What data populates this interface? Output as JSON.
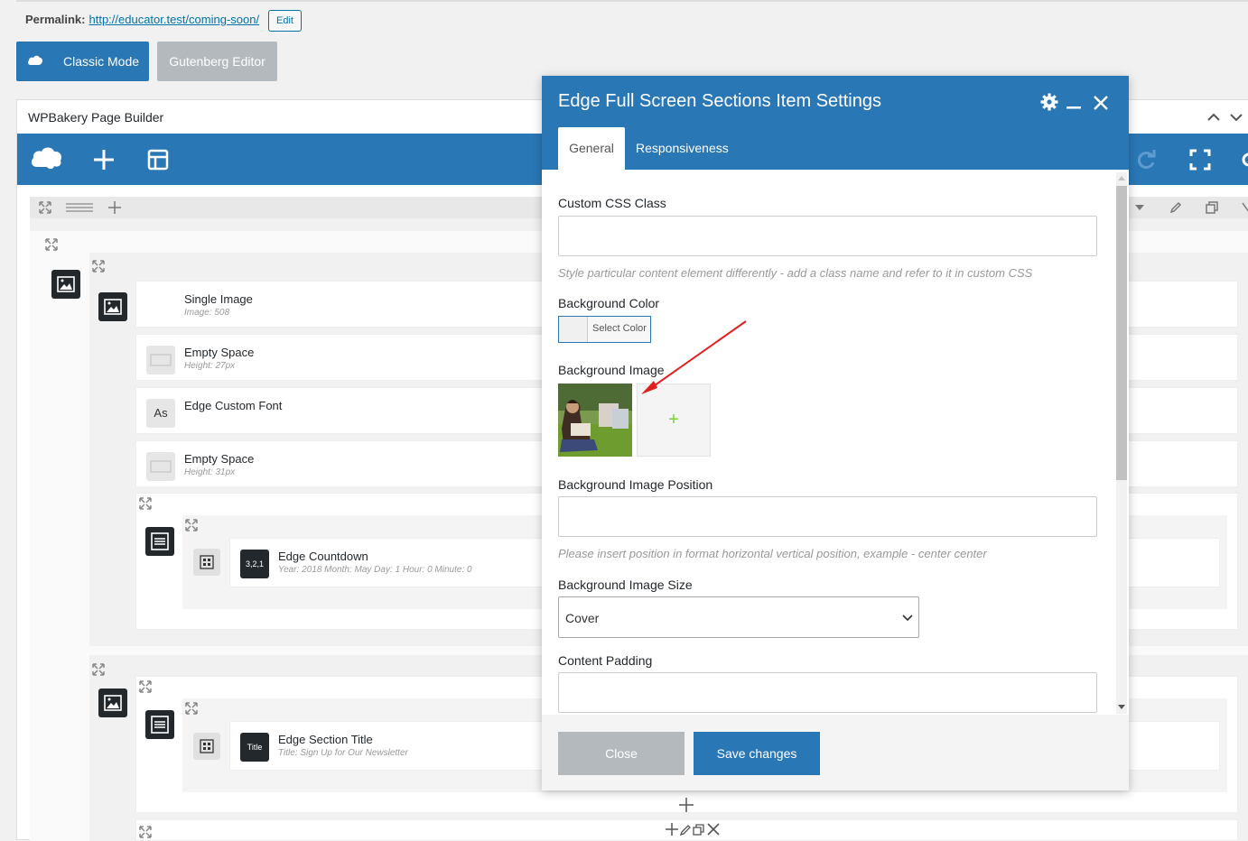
{
  "permalink": {
    "label": "Permalink:",
    "url": "http://educator.test/coming-soon/",
    "edit_label": "Edit"
  },
  "editor_modes": {
    "classic_label": "Classic Mode",
    "gutenberg_label": "Gutenberg Editor"
  },
  "builder": {
    "title": "WPBakery Page Builder",
    "elements": [
      {
        "title": "Single Image",
        "sub": "Image: 508"
      },
      {
        "title": "Empty Space",
        "sub": "Height: 27px"
      },
      {
        "title": "Edge Custom Font",
        "sub": "",
        "icon_text": "As"
      },
      {
        "title": "Empty Space",
        "sub": "Height: 31px"
      },
      {
        "title": "Edge Countdown",
        "sub": "Year: 2018  Month: May  Day: 1  Hour: 0  Minute: 0",
        "icon_text": "3,2,1"
      },
      {
        "title": "Edge Section Title",
        "sub": "Title: Sign Up for Our Newsletter",
        "icon_text": "Title"
      }
    ]
  },
  "modal": {
    "title": "Edge Full Screen Sections Item Settings",
    "tabs": [
      {
        "label": "General",
        "active": true
      },
      {
        "label": "Responsiveness",
        "active": false
      }
    ],
    "fields": {
      "custom_css_class": {
        "label": "Custom CSS Class",
        "value": "",
        "help": "Style particular content element differently - add a class name and refer to it in custom CSS"
      },
      "background_color": {
        "label": "Background Color",
        "button_label": "Select Color"
      },
      "background_image": {
        "label": "Background Image",
        "add_symbol": "+"
      },
      "background_image_position": {
        "label": "Background Image Position",
        "value": "",
        "help": "Please insert position in format horizontal vertical position, example - center center"
      },
      "background_image_size": {
        "label": "Background Image Size",
        "selected": "Cover"
      },
      "content_padding": {
        "label": "Content Padding",
        "value": ""
      }
    },
    "close_label": "Close",
    "save_label": "Save changes"
  },
  "colors": {
    "accent": "#2a77b6",
    "arrow": "#e0201e",
    "add_plus": "#7ad03a"
  }
}
